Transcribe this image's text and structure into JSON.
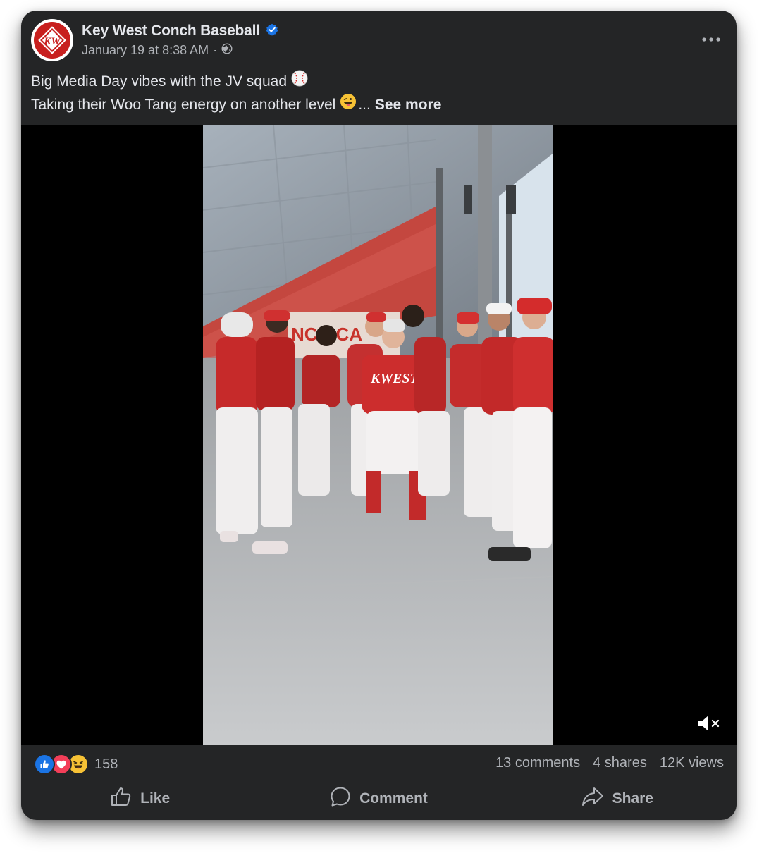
{
  "post": {
    "author": "Key West Conch Baseball",
    "avatar_text": "KW",
    "verified_icon": "verified-badge-icon",
    "date": "January 19 at 8:38 AM",
    "separator": "·",
    "audience_icon": "globe-icon",
    "more_icon": "more-dots-icon",
    "caption_line1": "Big Media Day vibes with the JV squad",
    "caption_line1_emoji": "baseball-emoji",
    "caption_line2": "Taking their Woo Tang energy on another level",
    "caption_line2_emoji": "tongue-wink-emoji",
    "ellipsis": "...",
    "see_more": "See more"
  },
  "video": {
    "jersey_text": "KWEST",
    "building_text": "NCH CA",
    "mute_icon": "muted-speaker-icon"
  },
  "stats": {
    "reaction_icons": [
      "like-reaction-icon",
      "love-reaction-icon",
      "haha-reaction-icon"
    ],
    "reaction_count": "158",
    "comments": "13 comments",
    "shares": "4 shares",
    "views": "12K views"
  },
  "actions": {
    "like": "Like",
    "comment": "Comment",
    "share": "Share"
  },
  "colors": {
    "card_bg": "#242526",
    "text_primary": "#e4e6eb",
    "text_secondary": "#b0b3b8",
    "verified_blue": "#1b74e4",
    "brand_red": "#d42a2a",
    "love_red": "#f33e58"
  }
}
